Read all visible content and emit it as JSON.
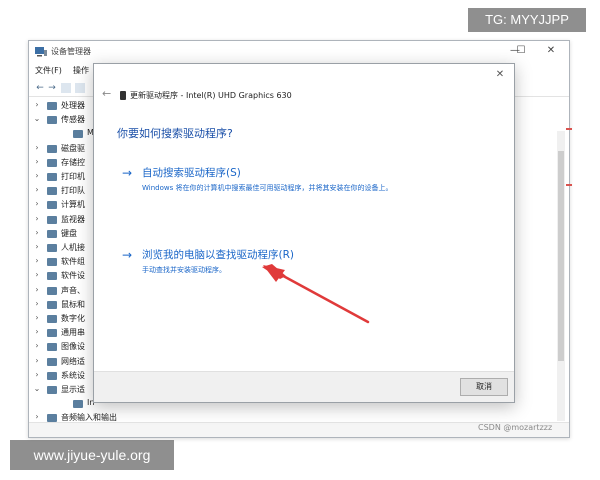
{
  "device_manager": {
    "title": "设备管理器",
    "controls": {
      "minimize": "—",
      "maximize": "☐",
      "close": "✕"
    },
    "menu": [
      "文件(F)",
      "操作"
    ],
    "tree_items": [
      {
        "label": "处理器",
        "expander": "›",
        "icon": "cpu-icon"
      },
      {
        "label": "传感器",
        "expander": "⌄",
        "icon": "sensor-icon"
      },
      {
        "label": "M",
        "expander": "",
        "icon": "sensor-device-icon",
        "child": true
      },
      {
        "label": "磁盘驱",
        "expander": "›",
        "icon": "disk-icon"
      },
      {
        "label": "存储控",
        "expander": "›",
        "icon": "storage-icon"
      },
      {
        "label": "打印机",
        "expander": "›",
        "icon": "printer-icon"
      },
      {
        "label": "打印队",
        "expander": "›",
        "icon": "print-queue-icon"
      },
      {
        "label": "计算机",
        "expander": "›",
        "icon": "computer-icon"
      },
      {
        "label": "监视器",
        "expander": "›",
        "icon": "monitor-icon"
      },
      {
        "label": "键盘",
        "expander": "›",
        "icon": "keyboard-icon"
      },
      {
        "label": "人机接",
        "expander": "›",
        "icon": "hid-icon"
      },
      {
        "label": "软件组",
        "expander": "›",
        "icon": "software-component-icon"
      },
      {
        "label": "软件设",
        "expander": "›",
        "icon": "software-device-icon"
      },
      {
        "label": "声音、",
        "expander": "›",
        "icon": "sound-icon"
      },
      {
        "label": "鼠标和",
        "expander": "›",
        "icon": "mouse-icon"
      },
      {
        "label": "数字化",
        "expander": "›",
        "icon": "digitizer-icon"
      },
      {
        "label": "通用串",
        "expander": "›",
        "icon": "usb-icon"
      },
      {
        "label": "图像设",
        "expander": "›",
        "icon": "camera-icon"
      },
      {
        "label": "网络适",
        "expander": "›",
        "icon": "network-icon"
      },
      {
        "label": "系统设",
        "expander": "›",
        "icon": "system-icon"
      },
      {
        "label": "显示适",
        "expander": "⌄",
        "icon": "display-adapter-icon"
      },
      {
        "label": "In",
        "expander": "",
        "icon": "gpu-icon",
        "child": true
      },
      {
        "label": "音频输入和输出",
        "expander": "›",
        "icon": "audio-io-icon"
      }
    ]
  },
  "dialog": {
    "header_title": "更新驱动程序 - Intel(R) UHD Graphics 630",
    "question": "你要如何搜索驱动程序?",
    "close_glyph": "✕",
    "back_glyph": "←",
    "options": [
      {
        "arrow": "→",
        "title": "自动搜索驱动程序(S)",
        "description": "Windows 将在你的计算机中搜索最佳可用驱动程序，并将其安装在你的设备上。"
      },
      {
        "arrow": "→",
        "title": "浏览我的电脑以查找驱动程序(R)",
        "description": "手动查找并安装驱动程序。"
      }
    ],
    "cancel_label": "取消"
  },
  "watermarks": {
    "tg": "TG: MYYJJPP",
    "site": "www.jiyue-yule.org",
    "csdn": "CSDN @mozartzzz"
  },
  "colors": {
    "link_blue": "#1a66c8",
    "question_blue": "#1a4fa8",
    "annotation_red": "#e03a3a"
  }
}
